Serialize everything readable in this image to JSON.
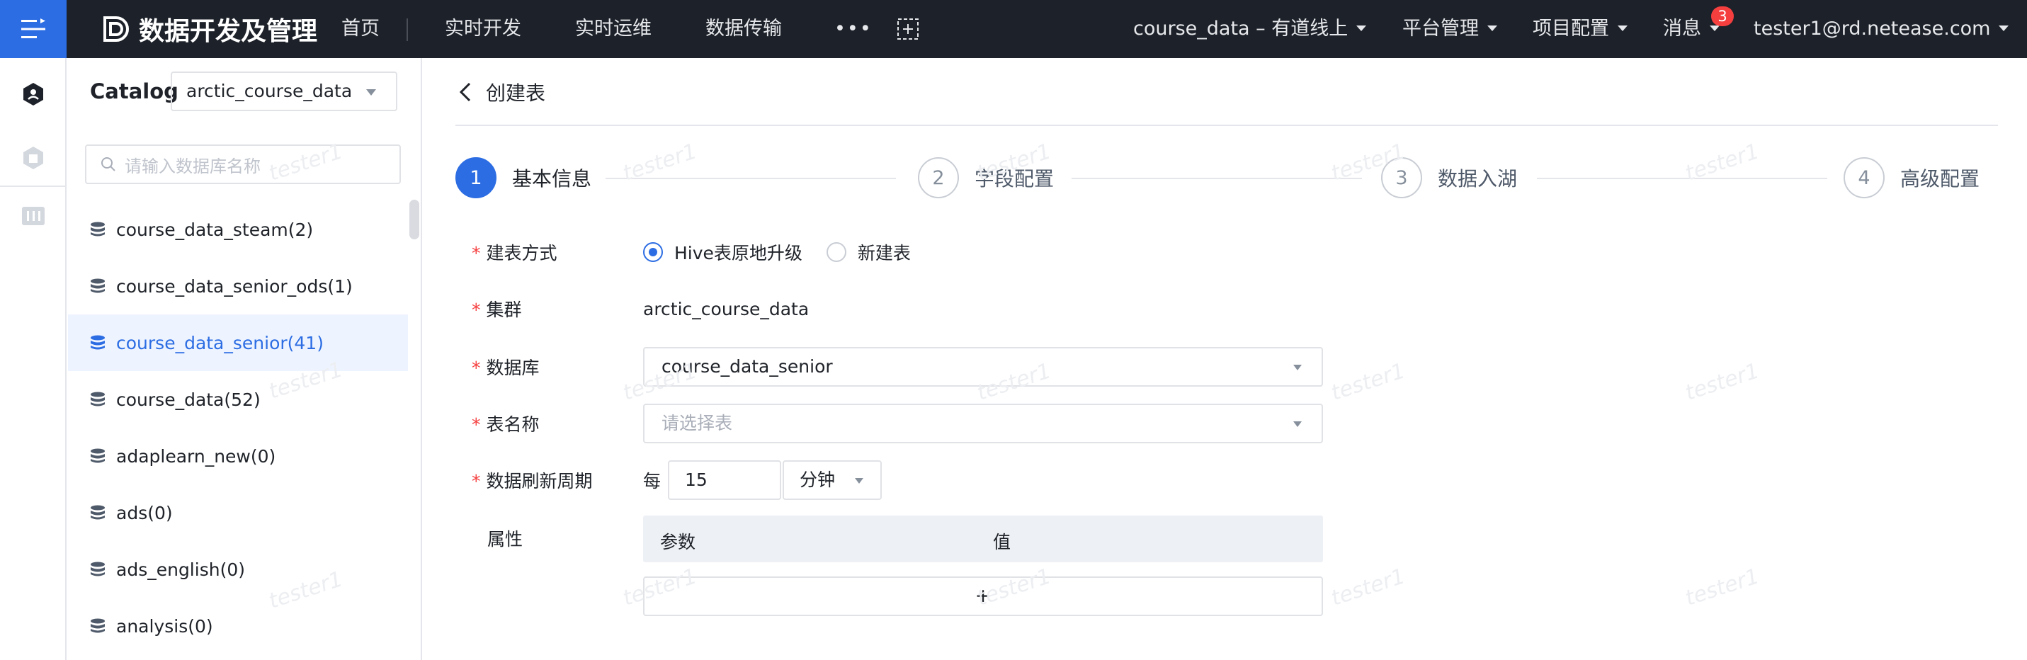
{
  "app": {
    "title": "数据开发及管理",
    "nav": [
      "首页",
      "实时开发",
      "实时运维",
      "数据传输"
    ],
    "more": "•••",
    "project": "course_data – 有道线上",
    "platform_menu": "平台管理",
    "project_menu": "项目配置",
    "messages": "消息",
    "message_count": "3",
    "user": "tester1@rd.netease.com",
    "accent": "#2c6de3"
  },
  "catalog": {
    "label": "Catalog",
    "selected": "arctic_course_data",
    "search_placeholder": "请输入数据库名称",
    "databases": [
      {
        "name": "course_data_steam(2)",
        "active": false
      },
      {
        "name": "course_data_senior_ods(1)",
        "active": false
      },
      {
        "name": "course_data_senior(41)",
        "active": true
      },
      {
        "name": "course_data(52)",
        "active": false
      },
      {
        "name": "adaplearn_new(0)",
        "active": false
      },
      {
        "name": "ads(0)",
        "active": false
      },
      {
        "name": "ads_english(0)",
        "active": false
      },
      {
        "name": "analysis(0)",
        "active": false
      }
    ]
  },
  "page": {
    "back_title": "创建表",
    "steps": [
      {
        "num": "1",
        "label": "基本信息",
        "active": true
      },
      {
        "num": "2",
        "label": "字段配置",
        "active": false
      },
      {
        "num": "3",
        "label": "数据入湖",
        "active": false
      },
      {
        "num": "4",
        "label": "高级配置",
        "active": false
      }
    ],
    "form": {
      "create_mode_label": "建表方式",
      "mode_option_1": "Hive表原地升级",
      "mode_option_2": "新建表",
      "cluster_label": "集群",
      "cluster_value": "arctic_course_data",
      "database_label": "数据库",
      "database_value": "course_data_senior",
      "table_label": "表名称",
      "table_placeholder": "请选择表",
      "refresh_label": "数据刷新周期",
      "refresh_prefix": "每",
      "refresh_value": "15",
      "refresh_unit": "分钟",
      "props_label": "属性",
      "props_col_param": "参数",
      "props_col_value": "值",
      "add_row": "+"
    }
  },
  "watermark": "tester1"
}
